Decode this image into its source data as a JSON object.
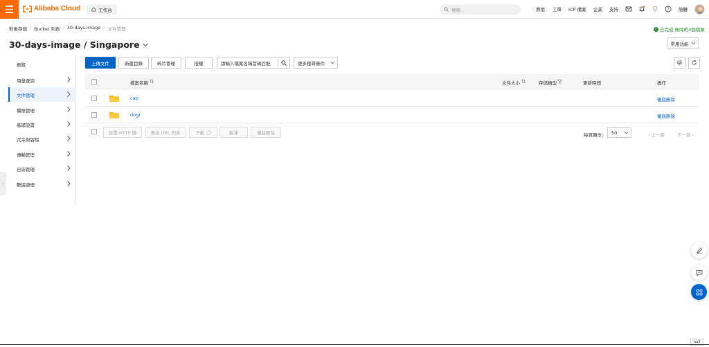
{
  "header": {
    "logo_text": "Alibaba Cloud",
    "workbench_label": "工作台",
    "search_placeholder": "搜索...",
    "nav": [
      "費用",
      "工單",
      "ICP 備案",
      "企業",
      "支持"
    ],
    "user_label": "簡體",
    "brand_color": "#ff6a00"
  },
  "breadcrumb": {
    "items": [
      "對象存儲",
      "Bucket 列表",
      "30-days-image",
      "文件管理"
    ]
  },
  "status": {
    "text": "已完成 刪除的4個檔案"
  },
  "page": {
    "title": "30-days-image / Singapore",
    "common_functions": "常用功能"
  },
  "sidebar": {
    "items": [
      {
        "label": "概覽",
        "has_chevron": false
      },
      {
        "label": "用量查詢",
        "has_chevron": true
      },
      {
        "label": "文件管理",
        "has_chevron": true,
        "active": true
      },
      {
        "label": "權限管理",
        "has_chevron": true
      },
      {
        "label": "基礎設置",
        "has_chevron": true
      },
      {
        "label": "冗余與容錯",
        "has_chevron": true
      },
      {
        "label": "傳輸管理",
        "has_chevron": true
      },
      {
        "label": "日誌管理",
        "has_chevron": true
      },
      {
        "label": "數據處理",
        "has_chevron": true
      }
    ]
  },
  "toolbar": {
    "upload": "上傳文件",
    "new_dir": "新建目錄",
    "fragments": "碎片管理",
    "authorize": "授權",
    "search_placeholder": "請輸入檔案名稱首碼匹配",
    "more_conditions": "更多搜尋條件"
  },
  "table": {
    "headers": {
      "name": "檔案名稱",
      "size": "文件大小",
      "storage": "存儲類型",
      "updated": "更新時間",
      "actions": "操作"
    },
    "rows": [
      {
        "name": "cat/",
        "action": "徹底刪除"
      },
      {
        "name": "dog/",
        "action": "徹底刪除"
      }
    ]
  },
  "footer": {
    "buttons": [
      "設置 HTTP 頭",
      "導出 URL 列表",
      "下載",
      "解凍",
      "徹底刪除"
    ],
    "per_page_label": "每頁顯示：",
    "per_page_value": "50",
    "prev": "上一頁",
    "next": "下一頁"
  },
  "misc": {
    "null_label": "null",
    "accent_color": "#0064c8",
    "success_color": "#2e8b3a"
  }
}
